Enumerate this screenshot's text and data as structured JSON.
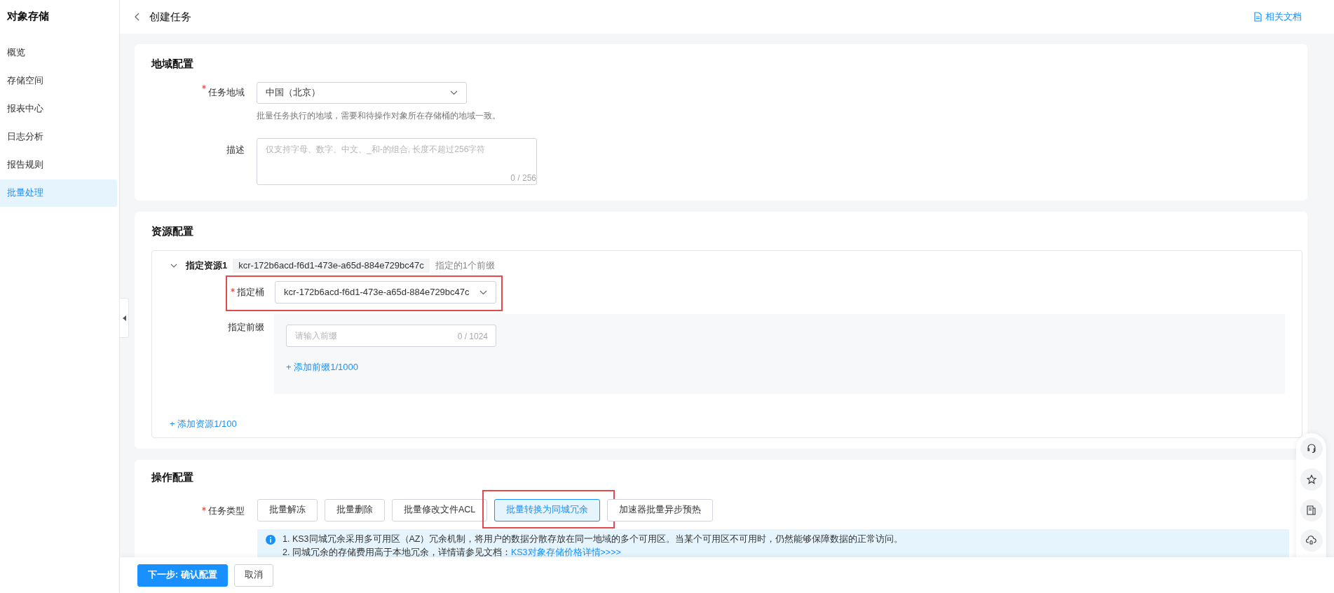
{
  "sidebar": {
    "title": "对象存储",
    "items": [
      {
        "label": "概览",
        "selected": false
      },
      {
        "label": "存储空间",
        "selected": false
      },
      {
        "label": "报表中心",
        "selected": false
      },
      {
        "label": "日志分析",
        "selected": false
      },
      {
        "label": "报告规则",
        "selected": false
      },
      {
        "label": "批量处理",
        "selected": true
      }
    ]
  },
  "header": {
    "title": "创建任务",
    "docs_link": "相关文档"
  },
  "region_section": {
    "title": "地域配置",
    "task_region": {
      "label": "任务地域",
      "required": true,
      "value": "中国（北京）",
      "hint": "批量任务执行的地域，需要和待操作对象所在存储桶的地域一致。"
    },
    "description": {
      "label": "描述",
      "placeholder": "仅支持字母、数字、中文、_和-的组合, 长度不超过256字符",
      "counter": "0 / 256"
    }
  },
  "resource_section": {
    "title": "资源配置",
    "resources": [
      {
        "title": "指定资源1",
        "expanded": true,
        "bucket_tag": "kcr-172b6acd-f6d1-473e-a65d-884e729bc47c",
        "prefix_summary": "指定的1个前缀",
        "bucket": {
          "label": "指定桶",
          "required": true,
          "value": "kcr-172b6acd-f6d1-473e-a65d-884e729bc47c",
          "highlighted": true
        },
        "prefix": {
          "label": "指定前缀",
          "placeholder": "请输入前缀",
          "counter": "0 / 1024",
          "add_link": "+ 添加前缀1/1000"
        }
      }
    ],
    "add_link": "+ 添加资源1/100"
  },
  "operation_section": {
    "title": "操作配置",
    "task_type": {
      "label": "任务类型",
      "required": true,
      "options": [
        {
          "label": "批量解冻",
          "selected": false,
          "highlighted": false
        },
        {
          "label": "批量删除",
          "selected": false,
          "highlighted": false
        },
        {
          "label": "批量修改文件ACL",
          "selected": false,
          "highlighted": false
        },
        {
          "label": "批量转换为同城冗余",
          "selected": true,
          "highlighted": true
        },
        {
          "label": "加速器批量异步预热",
          "selected": false,
          "highlighted": false
        }
      ]
    },
    "info": {
      "line_1": "1. KS3同城冗余采用多可用区（AZ）冗余机制，将用户的数据分散存放在同一地域的多个可用区。当某个可用区不可用时，仍然能够保障数据的正常访问。",
      "line_2": "2. 同城冗余的存储费用高于本地冗余，详情请参见文档：",
      "line_2_link": "KS3对象存储价格详情>>>>"
    }
  },
  "footer": {
    "buttons": [
      {
        "label": "下一步: 确认配置",
        "kind": "primary"
      },
      {
        "label": "取消",
        "kind": "default"
      }
    ]
  }
}
